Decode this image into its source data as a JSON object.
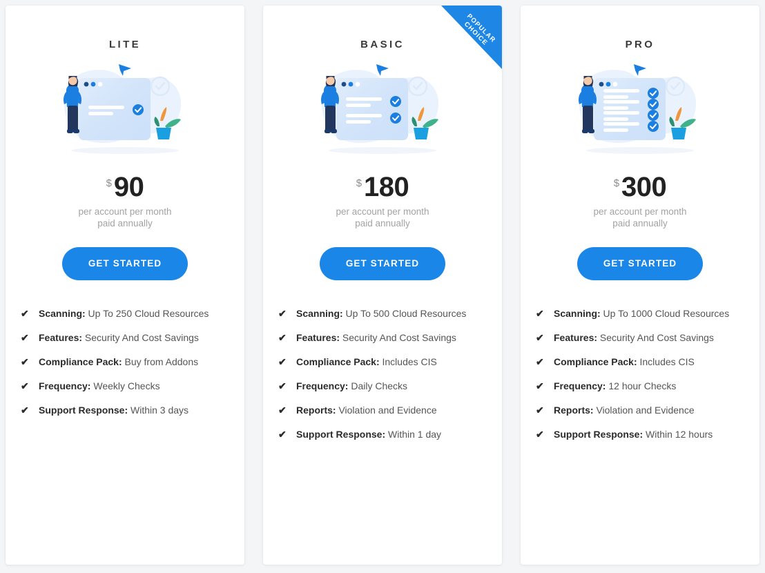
{
  "theme": {
    "accent": "#1a86e8",
    "ribbon": "#1e87e5",
    "page_bg": "#f4f5f7",
    "card_bg": "#ffffff",
    "price_color": "#222222",
    "muted_text": "#a3a3a3"
  },
  "plans": [
    {
      "id": "lite",
      "title": "LITE",
      "illustration": "pricing-person-checklist-illustration",
      "check_rows": 1,
      "currency": "$",
      "amount": "90",
      "sub_line_1": "per account per month",
      "sub_line_2": "paid annually",
      "cta_label": "GET STARTED",
      "badge": null,
      "features": [
        {
          "label": "Scanning:",
          "value": "Up To 250 Cloud Resources"
        },
        {
          "label": "Features:",
          "value": "Security And Cost Savings"
        },
        {
          "label": "Compliance Pack:",
          "value": "Buy from Addons"
        },
        {
          "label": "Frequency:",
          "value": "Weekly Checks"
        },
        {
          "label": "Support Response:",
          "value": "Within 3 days"
        }
      ]
    },
    {
      "id": "basic",
      "title": "BASIC",
      "illustration": "pricing-person-checklist-illustration",
      "check_rows": 2,
      "currency": "$",
      "amount": "180",
      "sub_line_1": "per account per month",
      "sub_line_2": "paid annually",
      "cta_label": "GET STARTED",
      "badge": {
        "line1": "POPULAR",
        "line2": "CHOICE"
      },
      "features": [
        {
          "label": "Scanning:",
          "value": "Up To 500 Cloud Resources"
        },
        {
          "label": "Features:",
          "value": "Security And Cost Savings"
        },
        {
          "label": "Compliance Pack:",
          "value": "Includes CIS"
        },
        {
          "label": "Frequency:",
          "value": "Daily Checks"
        },
        {
          "label": "Reports:",
          "value": "Violation and Evidence"
        },
        {
          "label": "Support Response:",
          "value": "Within 1 day"
        }
      ]
    },
    {
      "id": "pro",
      "title": "PRO",
      "illustration": "pricing-person-checklist-illustration",
      "check_rows": 4,
      "currency": "$",
      "amount": "300",
      "sub_line_1": "per account per month",
      "sub_line_2": "paid annually",
      "cta_label": "GET STARTED",
      "badge": null,
      "features": [
        {
          "label": "Scanning:",
          "value": "Up To 1000 Cloud Resources"
        },
        {
          "label": "Features:",
          "value": "Security And Cost Savings"
        },
        {
          "label": "Compliance Pack:",
          "value": "Includes CIS"
        },
        {
          "label": "Frequency:",
          "value": "12 hour Checks"
        },
        {
          "label": "Reports:",
          "value": "Violation and Evidence"
        },
        {
          "label": "Support Response:",
          "value": "Within 12 hours"
        }
      ]
    }
  ],
  "icons": {
    "check": "✔"
  }
}
